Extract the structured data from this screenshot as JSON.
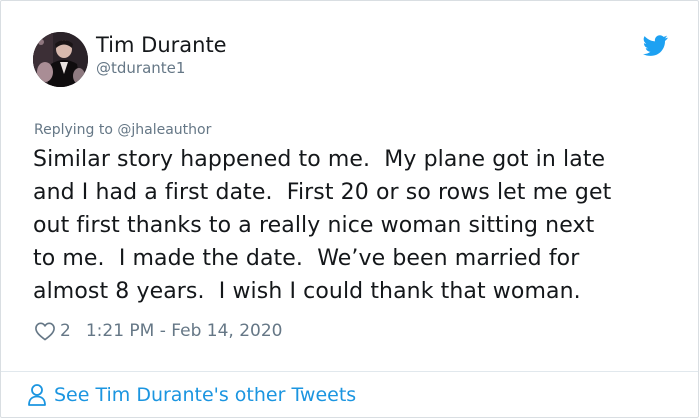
{
  "author": {
    "name": "Tim Durante",
    "handle": "@tdurante1"
  },
  "reply": {
    "text": "Replying to @jhaleauthor"
  },
  "tweet": {
    "lines": [
      "Similar story happened to me.  My plane got in late",
      "and I had a first date.  First 20 or so rows let me get",
      "out first thanks to a really nice woman sitting next",
      "to me.  I made the date.  We’ve been married for",
      "almost 8 years.  I wish I could thank that woman."
    ]
  },
  "meta": {
    "like_count": "2",
    "timestamp": "1:21 PM - Feb 14, 2020"
  },
  "footer": {
    "other_tweets_label": "See Tim Durante's other Tweets"
  },
  "icons": {
    "brand": "twitter-bird-icon",
    "like": "heart-outline-icon",
    "footer": "person-icon"
  },
  "colors": {
    "brand_blue": "#1da1f2",
    "link_blue": "#1b95e0",
    "muted_gray": "#657786",
    "text": "#14171a"
  }
}
